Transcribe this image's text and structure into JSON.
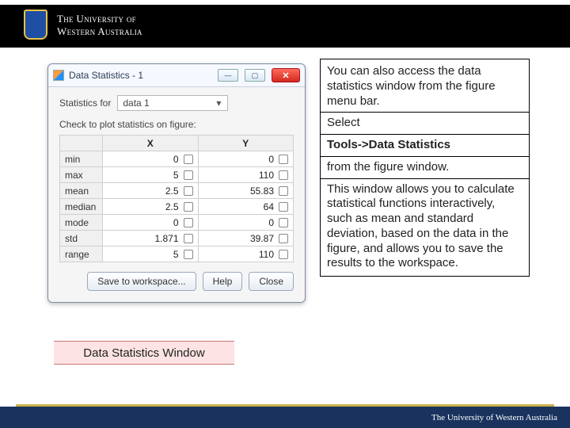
{
  "header": {
    "line1": "The University of",
    "line2": "Western Australia"
  },
  "window": {
    "title": "Data Statistics - 1",
    "stats_for_label": "Statistics for",
    "series_selected": "data 1",
    "subcaption": "Check to plot statistics on figure:",
    "columns": {
      "x": "X",
      "y": "Y"
    },
    "rows": [
      {
        "name": "min",
        "x": "0",
        "y": "0"
      },
      {
        "name": "max",
        "x": "5",
        "y": "110"
      },
      {
        "name": "mean",
        "x": "2.5",
        "y": "55.83"
      },
      {
        "name": "median",
        "x": "2.5",
        "y": "64"
      },
      {
        "name": "mode",
        "x": "0",
        "y": "0"
      },
      {
        "name": "std",
        "x": "1.871",
        "y": "39.87"
      },
      {
        "name": "range",
        "x": "5",
        "y": "110"
      }
    ],
    "buttons": {
      "save": "Save to workspace...",
      "help": "Help",
      "close": "Close"
    }
  },
  "caption": "Data Statistics Window",
  "textbox": {
    "p1": "You can also access the data statistics window from the figure menu bar.",
    "p2": "Select",
    "p3": "Tools->Data Statistics",
    "p4": "from the figure window.",
    "p5": "This window allows you to calculate statistical functions interactively, such as mean and standard deviation, based on the data in the figure, and allows you to save the results to the workspace."
  },
  "footer": "The University of Western Australia"
}
